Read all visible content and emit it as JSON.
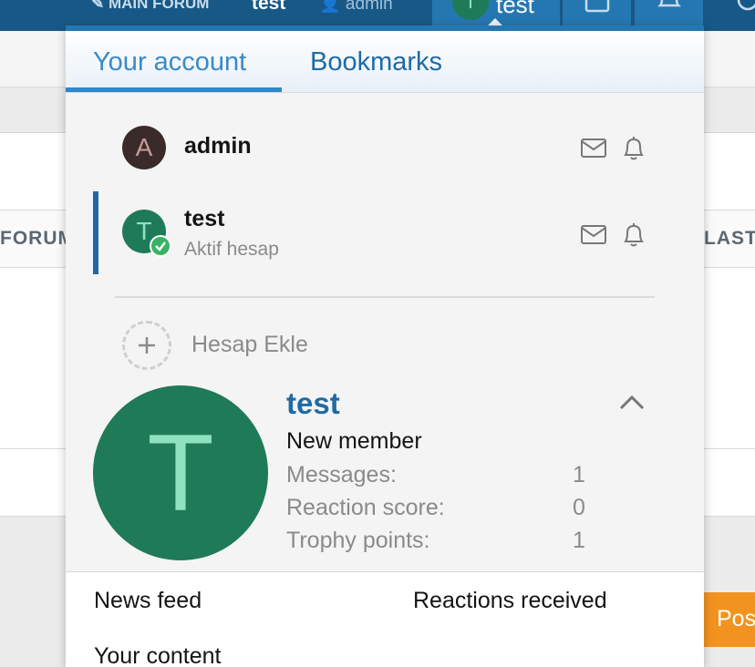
{
  "topbar": {
    "main_forum": "✎ MAIN FORUM",
    "user_name": "test",
    "admin_label": "👤 admin",
    "avatar_letter": "T",
    "active_user": "test"
  },
  "background": {
    "forum_col": "FORUM",
    "last_col": "LAST P",
    "post_button": "Pos"
  },
  "menu": {
    "tabs": [
      {
        "label": "Your account"
      },
      {
        "label": "Bookmarks"
      }
    ],
    "accounts": [
      {
        "letter": "A",
        "name": "admin",
        "status": ""
      },
      {
        "letter": "T",
        "name": "test",
        "status": "Aktif hesap"
      }
    ],
    "add_account_label": "Hesap Ekle",
    "profile": {
      "avatar_letter": "T",
      "name": "test",
      "title": "New member",
      "stats": [
        {
          "label": "Messages:",
          "value": "1"
        },
        {
          "label": "Reaction score:",
          "value": "0"
        },
        {
          "label": "Trophy points:",
          "value": "1"
        }
      ]
    },
    "links": [
      {
        "label": "News feed"
      },
      {
        "label": "Reactions received"
      },
      {
        "label": "Your content"
      }
    ]
  },
  "colors": {
    "header_blue": "#185886",
    "link_blue": "#1f6aa5",
    "avatar_green": "#1f7a58",
    "avatar_admin": "#3b2a2a",
    "status_green": "#39b264",
    "post_orange": "#f29320"
  }
}
